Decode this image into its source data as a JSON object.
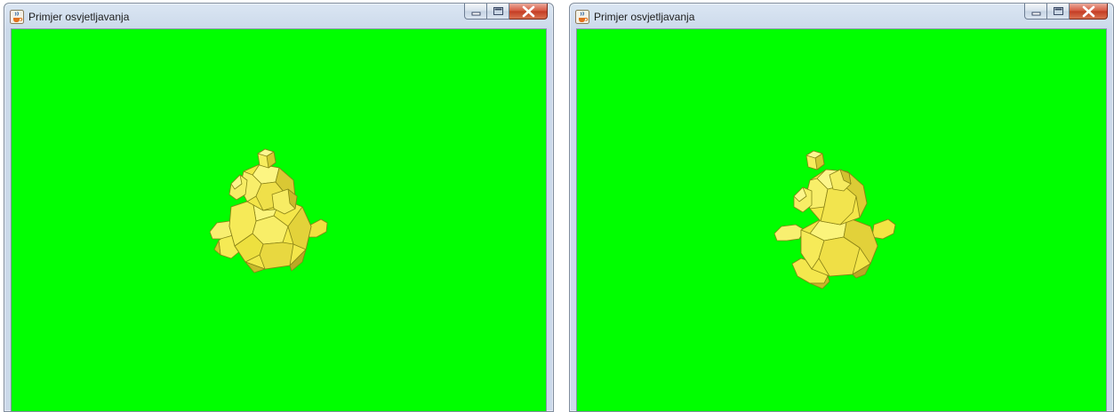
{
  "windows": [
    {
      "title": "Primjer osvjetljavanja",
      "icon": "java-cup-icon",
      "controls": [
        "minimize-icon",
        "maximize-icon",
        "close-icon"
      ],
      "viewport_color": "#00ff00",
      "model_color": "#f5e84a"
    },
    {
      "title": "Primjer osvjetljavanja",
      "icon": "java-cup-icon",
      "controls": [
        "minimize-icon",
        "maximize-icon",
        "close-icon"
      ],
      "viewport_color": "#00ff00",
      "model_color": "#f5e84a"
    }
  ]
}
